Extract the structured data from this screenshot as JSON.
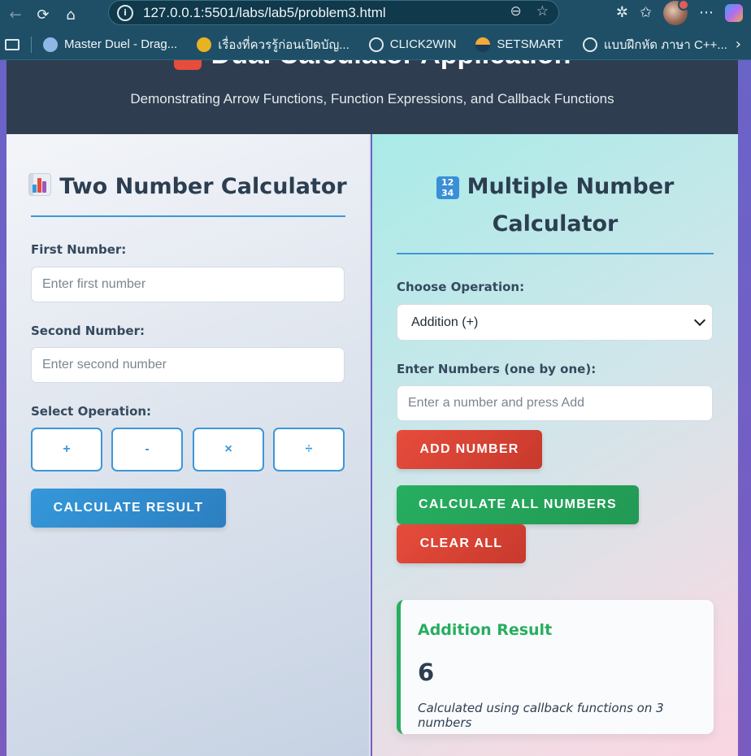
{
  "browser": {
    "url": "127.0.0.1:5501/labs/lab5/problem3.html",
    "bookmarks": [
      {
        "label": "Master Duel - Drag...",
        "icon": "game-icon",
        "color": "#8fb7e6"
      },
      {
        "label": "เรื่องที่ควรรู้ก่อนเปิดบัญ...",
        "icon": "bank-icon",
        "color": "#e8b321"
      },
      {
        "label": "CLICK2WIN",
        "icon": "globe-icon",
        "color": "#dfe8ec"
      },
      {
        "label": "SETSMART",
        "icon": "set-icon",
        "color": "#f0a93a"
      },
      {
        "label": "แบบฝึกหัด ภาษา C++...",
        "icon": "globe-icon",
        "color": "#dfe8ec"
      }
    ]
  },
  "header": {
    "title": "Dual Calculator Application",
    "subtitle": "Demonstrating Arrow Functions, Function Expressions, and Callback Functions"
  },
  "left": {
    "title": "Two Number Calculator",
    "first_label": "First Number:",
    "first_placeholder": "Enter first number",
    "second_label": "Second Number:",
    "second_placeholder": "Enter second number",
    "operation_label": "Select Operation:",
    "operations": [
      "+",
      "-",
      "×",
      "÷"
    ],
    "calculate_label": "CALCULATE RESULT"
  },
  "right": {
    "title_line1": "Multiple Number",
    "title_line2": "Calculator",
    "choose_label": "Choose Operation:",
    "selected_operation": "Addition (+)",
    "numbers_label": "Enter Numbers (one by one):",
    "number_placeholder": "Enter a number and press Add",
    "add_label": "ADD NUMBER",
    "calculate_all_label": "CALCULATE ALL NUMBERS",
    "clear_label": "CLEAR ALL",
    "result": {
      "title": "Addition Result",
      "value": "6",
      "note": "Calculated using callback functions on 3 numbers"
    }
  },
  "colors": {
    "header_bg": "#2e3e50",
    "primary_blue": "#3498db",
    "red": "#e74c3c",
    "green": "#27ae60"
  }
}
